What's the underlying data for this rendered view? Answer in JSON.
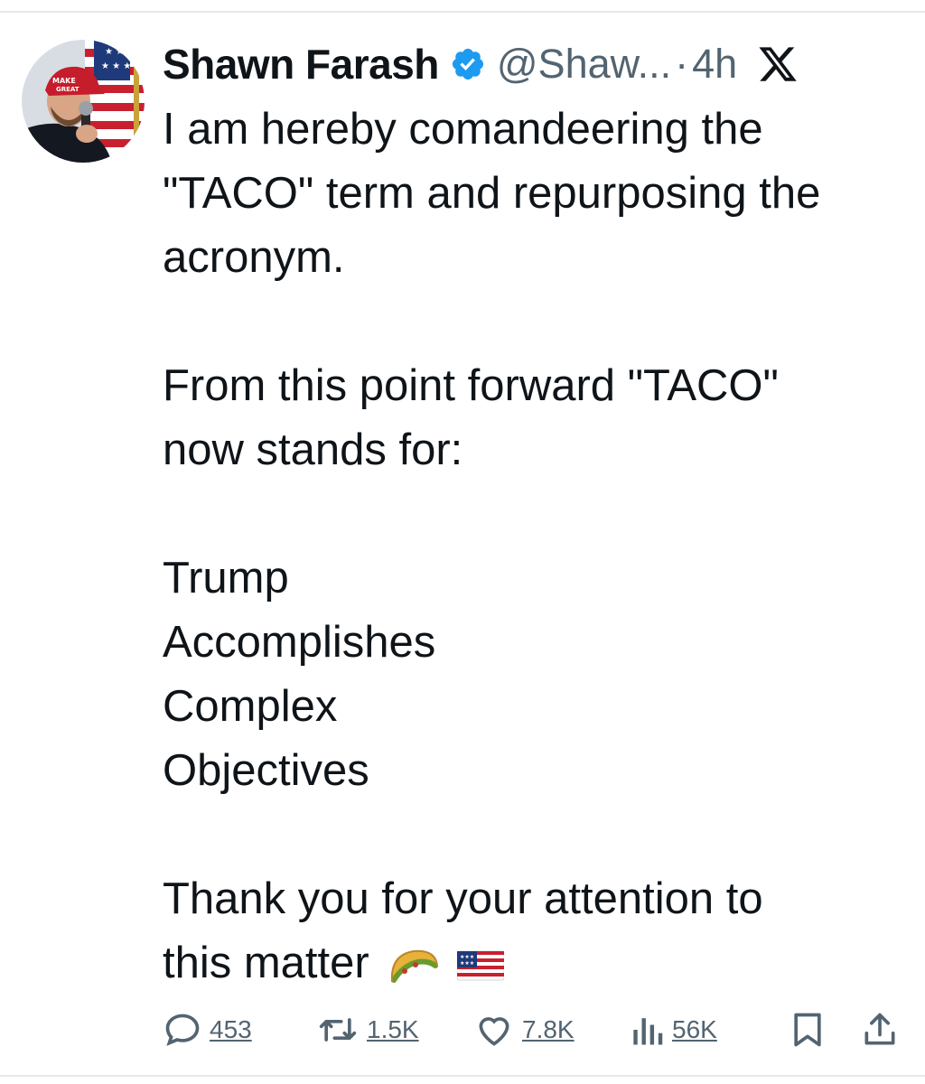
{
  "tweet": {
    "author": {
      "name": "Shawn Farash",
      "handle": "@Shaw...",
      "verified": true,
      "avatar_hat_text": [
        "MAKE",
        "GREAT"
      ]
    },
    "time_separator": "·",
    "time": "4h",
    "platform_icon": "x-logo-icon",
    "text_lines": [
      "I am hereby comandeering the",
      "\"TACO\" term and repurposing the",
      "acronym.",
      "",
      "From this point forward \"TACO\"",
      "now stands for:",
      "",
      "Trump",
      "Accomplishes",
      "Complex",
      "Objectives",
      "",
      "Thank you for your attention to",
      "this matter"
    ],
    "trailing_emojis": [
      "taco-icon",
      "us-flag-icon"
    ],
    "stats": {
      "replies": "453",
      "retweets": "1.5K",
      "likes": "7.8K",
      "views": "56K"
    }
  },
  "colors": {
    "text": "#0f1419",
    "secondary": "#536471",
    "verified": "#1d9bf0",
    "divider": "#e6e9ec"
  }
}
